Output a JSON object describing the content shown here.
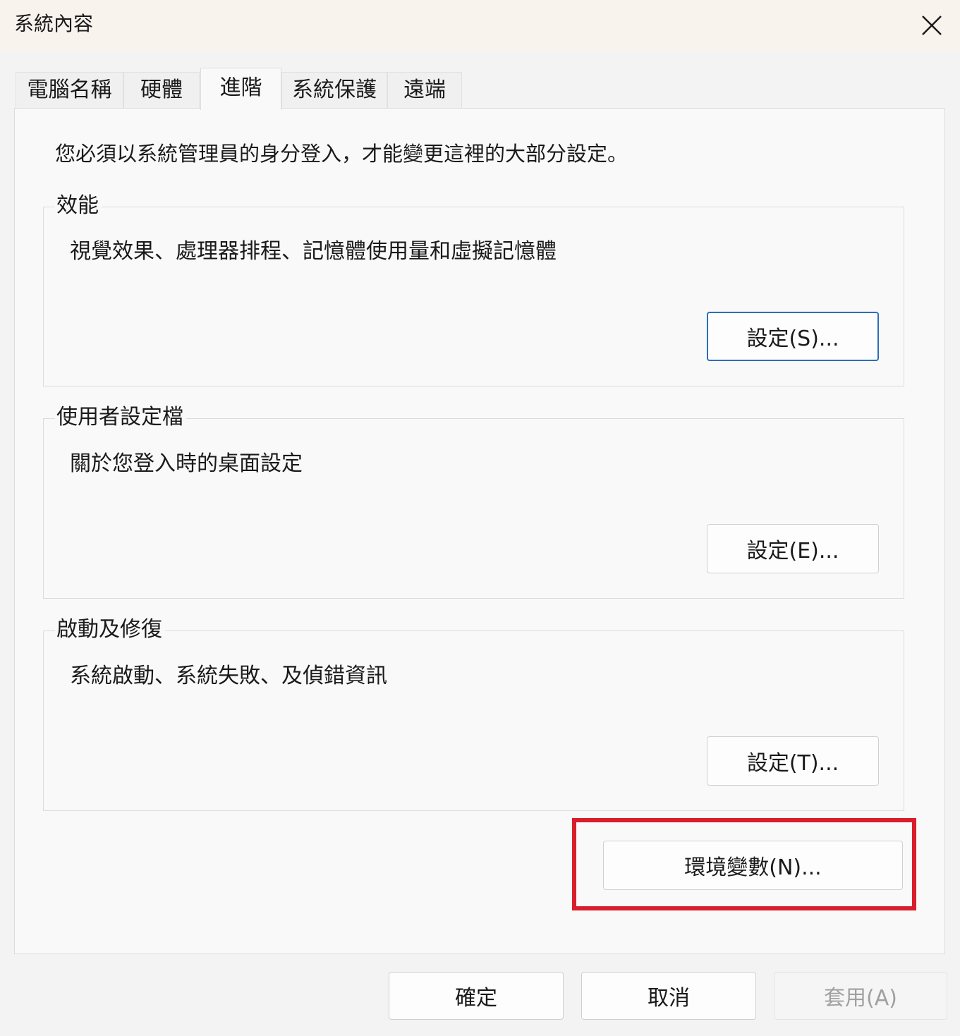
{
  "window": {
    "title": "系統內容",
    "close_icon": "close-icon"
  },
  "tabs": [
    {
      "label": "電腦名稱",
      "active": false
    },
    {
      "label": "硬體",
      "active": false
    },
    {
      "label": "進階",
      "active": true
    },
    {
      "label": "系統保護",
      "active": false
    },
    {
      "label": "遠端",
      "active": false
    }
  ],
  "advanced": {
    "notice": "您必須以系統管理員的身分登入，才能變更這裡的大部分設定。",
    "performance": {
      "title": "效能",
      "description": "視覺效果、處理器排程、記憶體使用量和虛擬記憶體",
      "button": "設定(S)..."
    },
    "user_profiles": {
      "title": "使用者設定檔",
      "description": "關於您登入時的桌面設定",
      "button": "設定(E)..."
    },
    "startup_recovery": {
      "title": "啟動及修復",
      "description": "系統啟動、系統失敗、及偵錯資訊",
      "button": "設定(T)..."
    },
    "env_button": "環境變數(N)..."
  },
  "footer": {
    "ok": "確定",
    "cancel": "取消",
    "apply": "套用(A)"
  },
  "colors": {
    "highlight": "#d81e2a",
    "focus_border": "#2a6fb7"
  }
}
